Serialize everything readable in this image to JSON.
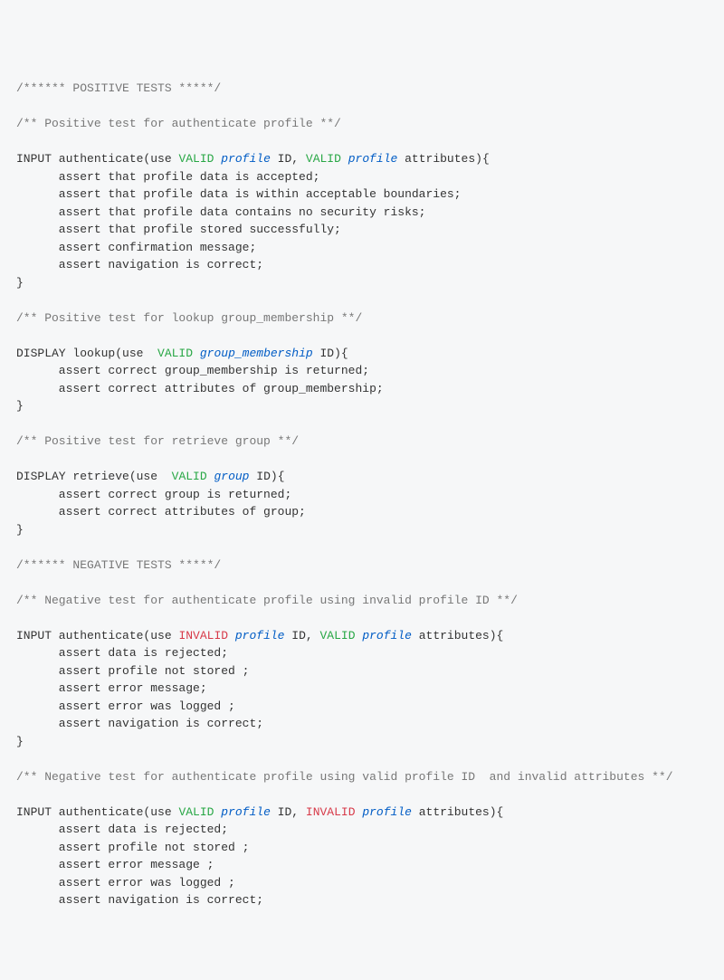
{
  "sec_pos": "/****** POSITIVE TESTS *****/",
  "sec_neg": "/****** NEGATIVE TESTS *****/",
  "t1_cmt": "/** Positive test for authenticate profile **/",
  "t1_l1_a": "INPUT authenticate(use ",
  "t1_l1_valid1": "VALID",
  "t1_l1_sp": " ",
  "t1_l1_ent1": "profile",
  "t1_l1_b": " ID, ",
  "t1_l1_valid2": "VALID",
  "t1_l1_ent2": "profile",
  "t1_l1_c": " attributes){",
  "t1_a1": "      assert that profile data is accepted;",
  "t1_a2": "      assert that profile data is within acceptable boundaries;",
  "t1_a3": "      assert that profile data contains no security risks;",
  "t1_a4": "      assert that profile stored successfully;",
  "t1_a5": "      assert confirmation message;",
  "t1_a6": "      assert navigation is correct;",
  "t2_cmt": "/** Positive test for lookup group_membership **/",
  "t2_l1_a": "DISPLAY lookup(use  ",
  "t2_l1_valid": "VALID",
  "t2_l1_sp": " ",
  "t2_l1_ent": "group_membership",
  "t2_l1_b": " ID){",
  "t2_a1": "      assert correct group_membership is returned;",
  "t2_a2": "      assert correct attributes of group_membership;",
  "t3_cmt": "/** Positive test for retrieve group **/",
  "t3_l1_a": "DISPLAY retrieve(use  ",
  "t3_l1_valid": "VALID",
  "t3_l1_sp": " ",
  "t3_l1_ent": "group",
  "t3_l1_b": " ID){",
  "t3_a1": "      assert correct group is returned;",
  "t3_a2": "      assert correct attributes of group;",
  "t4_cmt": "/** Negative test for authenticate profile using invalid profile ID **/",
  "t4_l1_a": "INPUT authenticate(use ",
  "t4_l1_inv": "INVALID",
  "t4_l1_sp": " ",
  "t4_l1_ent1": "profile",
  "t4_l1_b": " ID, ",
  "t4_l1_valid": "VALID",
  "t4_l1_ent2": "profile",
  "t4_l1_c": " attributes){",
  "t4_a1": "      assert data is rejected;",
  "t4_a2": "      assert profile not stored ;",
  "t4_a3": "      assert error message;",
  "t4_a4": "      assert error was logged ;",
  "t4_a5": "      assert navigation is correct;",
  "t5_cmt": "/** Negative test for authenticate profile using valid profile ID  and invalid attributes **/",
  "t5_l1_a": "INPUT authenticate(use ",
  "t5_l1_valid": "VALID",
  "t5_l1_sp": " ",
  "t5_l1_ent1": "profile",
  "t5_l1_b": " ID, ",
  "t5_l1_inv": "INVALID",
  "t5_l1_ent2": "profile",
  "t5_l1_c": " attributes){",
  "t5_a1": "      assert data is rejected;",
  "t5_a2": "      assert profile not stored ;",
  "t5_a3": "      assert error message ;",
  "t5_a4": "      assert error was logged ;",
  "t5_a5": "      assert navigation is correct;",
  "close": "}"
}
